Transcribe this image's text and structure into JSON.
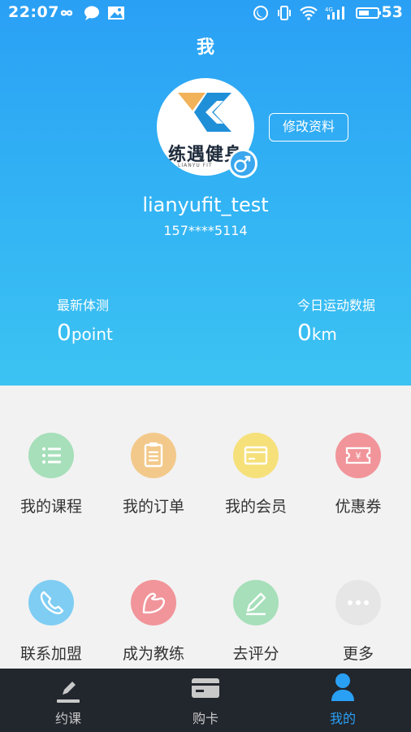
{
  "status_bar": {
    "time": "22:07",
    "battery": "53"
  },
  "page_title": "我",
  "profile": {
    "avatar_text": "练遇健身",
    "avatar_sub": "LIANYU FIT",
    "edit_button": "修改资料",
    "username": "lianyufit_test",
    "phone": "157****5114"
  },
  "stats": {
    "left": {
      "label": "最新体测",
      "value": "0",
      "unit": "point"
    },
    "right": {
      "label": "今日运动数据",
      "value": "0",
      "unit": "km"
    }
  },
  "menu": [
    {
      "label": "我的课程",
      "icon": "list-icon",
      "color": "#a6dfba"
    },
    {
      "label": "我的订单",
      "icon": "clipboard-icon",
      "color": "#f3c98b"
    },
    {
      "label": "我的会员",
      "icon": "card-icon",
      "color": "#f6e07a"
    },
    {
      "label": "优惠券",
      "icon": "coupon-icon",
      "color": "#f1959a"
    },
    {
      "label": "联系加盟",
      "icon": "phone-icon",
      "color": "#7fcdf3"
    },
    {
      "label": "成为教练",
      "icon": "muscle-icon",
      "color": "#f1959a"
    },
    {
      "label": "去评分",
      "icon": "pencil-icon",
      "color": "#a6dfba"
    },
    {
      "label": "更多",
      "icon": "more-icon",
      "color": "#e6e6e6"
    }
  ],
  "tabs": [
    {
      "label": "约课",
      "icon": "pencil-icon"
    },
    {
      "label": "购卡",
      "icon": "card-icon"
    },
    {
      "label": "我的",
      "icon": "person-icon",
      "active": true
    }
  ],
  "colors": {
    "header_top": "#2aa0f5",
    "header_bottom": "#3cc3f2",
    "tab_active": "#2aa0f5",
    "tabbar_bg": "#22262d"
  }
}
